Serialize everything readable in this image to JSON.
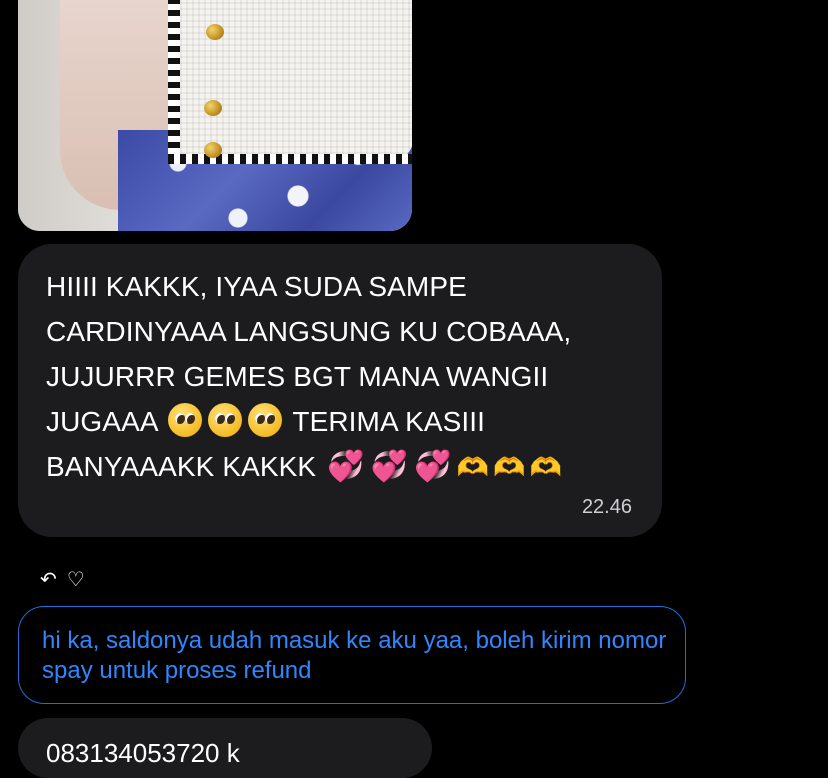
{
  "photo": {
    "description": ""
  },
  "message_1": {
    "text": "HIIII KAKKK, IYAA SUDA SAMPE CARDINYAAA LANGSUNG KU COBAAA, JUJURRR GEMES BGT MANA WANGII JUGAAA",
    "text_after_emojis": "TERIMA KASIII BANYAAAKK KAKKK",
    "time": "22.46",
    "emoji_pleading": "🥺",
    "emoji_hearts": "💞",
    "emoji_hands": "🫶"
  },
  "message_actions": {
    "reply_icon": "reply-arrow-icon",
    "like_icon": "heart-outline-icon",
    "reply_glyph": "↶",
    "like_glyph": "♡"
  },
  "message_2": {
    "text": "hi ka, saldonya udah masuk ke aku yaa, boleh kirim nomor spay untuk proses refund"
  },
  "message_3": {
    "text": "083134053720 k"
  },
  "colors": {
    "background": "#000000",
    "bubble": "#1c1c1e",
    "link_blue": "#2f86ff",
    "outline_blue": "#1e6fd6"
  }
}
